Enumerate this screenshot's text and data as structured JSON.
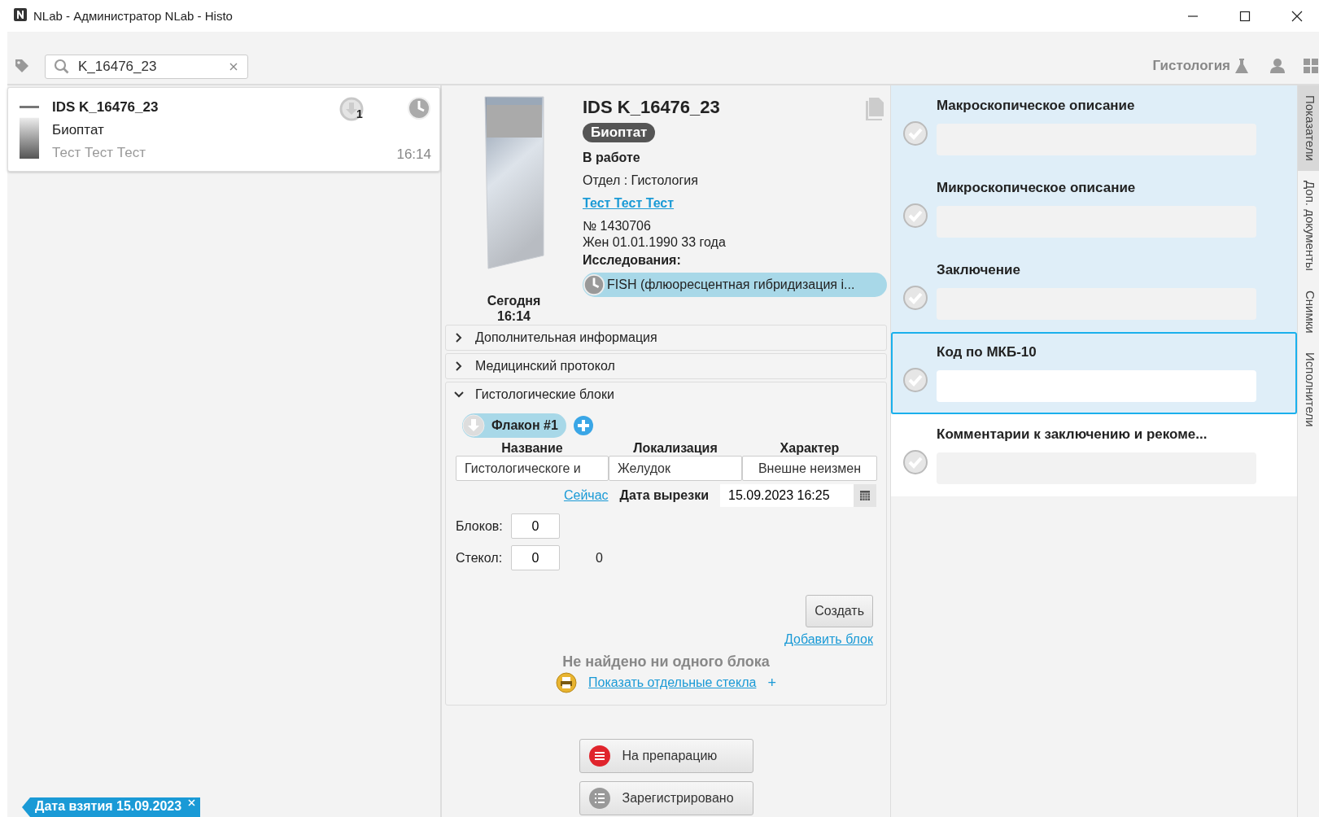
{
  "window": {
    "title": "NLab - Администратор NLab - Histo"
  },
  "toolbar": {
    "search": {
      "value": "K_16476_23"
    },
    "department": "Гистология"
  },
  "orders": [
    {
      "title": "IDS K_16476_23",
      "type": "Биоптат",
      "patient": "Тест Тест Тест",
      "time": "16:14",
      "badge": "1",
      "selected": true
    }
  ],
  "filter_tag": {
    "label": "Дата взятия 15.09.2023"
  },
  "order": {
    "date_day": "Сегодня",
    "date_time": "16:14",
    "title": "IDS K_16476_23",
    "type_badge": "Биоптат",
    "status": "В работе",
    "department": "Отдел : Гистология",
    "patient_link": "Тест Тест Тест",
    "number": "№ 1430706",
    "demographics": "Жен 01.01.1990 33 года",
    "studies_label": "Исследования:",
    "studies": [
      "FISH (флюоресцентная гибридизация i..."
    ]
  },
  "sections": [
    {
      "label": "Дополнительная информация",
      "expanded": false
    },
    {
      "label": "Медицинский протокол",
      "expanded": false
    },
    {
      "label": "Гистологические блоки",
      "expanded": true
    }
  ],
  "blocks": {
    "vials": [
      {
        "label": "Флакон #1",
        "selected": true
      }
    ],
    "columns": [
      "Название",
      "Локализация",
      "Характер"
    ],
    "values": [
      "Гистологическоге и",
      "Желудок",
      "Внешне неизмен"
    ],
    "now_link": "Сейчас",
    "cut_date_label": "Дата вырезки",
    "cut_date": "15.09.2023 16:25",
    "blocks_label": "Блоков:",
    "blocks_value": "0",
    "slides_label": "Стекол:",
    "slides_value": "0",
    "slides_total": "0",
    "create_button": "Создать",
    "add_block_link": "Добавить блок",
    "empty_message": "Не найдено ни одного блока",
    "show_slides_link": "Показать отдельные стекла",
    "plus": "+"
  },
  "actions": [
    {
      "label": "На препарацию",
      "kind": "danger"
    },
    {
      "label": "Зарегистрировано",
      "kind": "list"
    }
  ],
  "fields": [
    {
      "label": "Макроскопическое описание",
      "selected": false,
      "highlighted": true
    },
    {
      "label": "Микроскопическое описание",
      "selected": false,
      "highlighted": true
    },
    {
      "label": "Заключение",
      "selected": false,
      "highlighted": true
    },
    {
      "label": "Код по МКБ-10",
      "selected": true,
      "highlighted": true
    },
    {
      "label": "Комментарии к заключению и рекоме...",
      "selected": false,
      "highlighted": false
    }
  ],
  "side_tabs": [
    {
      "label": "Показатели",
      "selected": true
    },
    {
      "label": "Доп. документы",
      "selected": false
    },
    {
      "label": "Снимки",
      "selected": false
    },
    {
      "label": "Исполнители",
      "selected": false
    }
  ]
}
